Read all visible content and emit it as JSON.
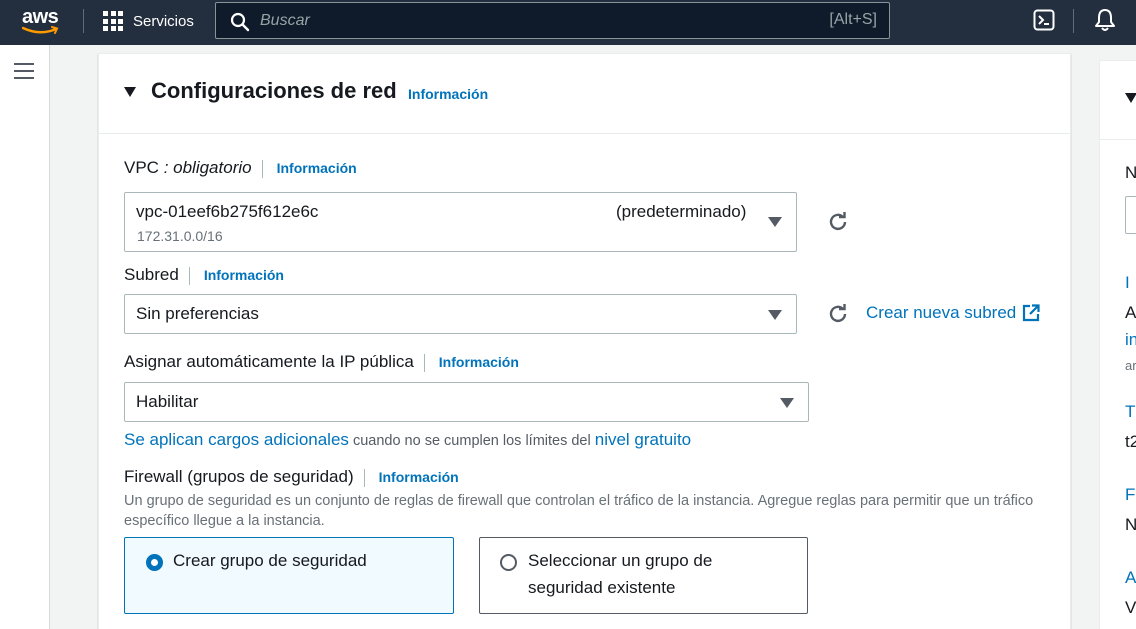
{
  "topnav": {
    "logo_text": "aws",
    "services_label": "Servicios",
    "search_placeholder": "Buscar",
    "search_shortcut": "[Alt+S]"
  },
  "network": {
    "title": "Configuraciones de red",
    "info": "Información",
    "vpc": {
      "label": "VPC",
      "required": " : obligatorio",
      "info": "Información",
      "value": "vpc-01eef6b275f612e6c",
      "default_tag": "(predeterminado)",
      "cidr": "172.31.0.0/16"
    },
    "subnet": {
      "label": "Subred",
      "info": "Información",
      "value": "Sin preferencias",
      "create_link": "Crear nueva subred"
    },
    "public_ip": {
      "label": "Asignar automáticamente la IP pública",
      "info": "Información",
      "value": "Habilitar",
      "charges_link": "Se aplican cargos adicionales",
      "charges_text": " cuando no se cumplen los límites del ",
      "free_tier_link": "nivel gratuito"
    },
    "firewall": {
      "label": "Firewall (grupos de seguridad)",
      "info": "Información",
      "description": "Un grupo de seguridad es un conjunto de reglas de firewall que controlan el tráfico de la instancia. Agregue reglas para permitir que un tráfico específico llegue a la instancia.",
      "options": [
        {
          "label": "Crear grupo de seguridad",
          "selected": true
        },
        {
          "label": "Seleccionar un grupo de seguridad existente",
          "selected": false
        }
      ]
    }
  },
  "right_panel": {
    "chars": [
      "N",
      "I",
      "A",
      "in",
      "ar",
      "T",
      "t2",
      "Fi",
      "N",
      "A",
      "V"
    ]
  },
  "colors": {
    "nav_bg": "#232f3e",
    "link": "#0073bb",
    "selected_bg": "#f1faff"
  }
}
